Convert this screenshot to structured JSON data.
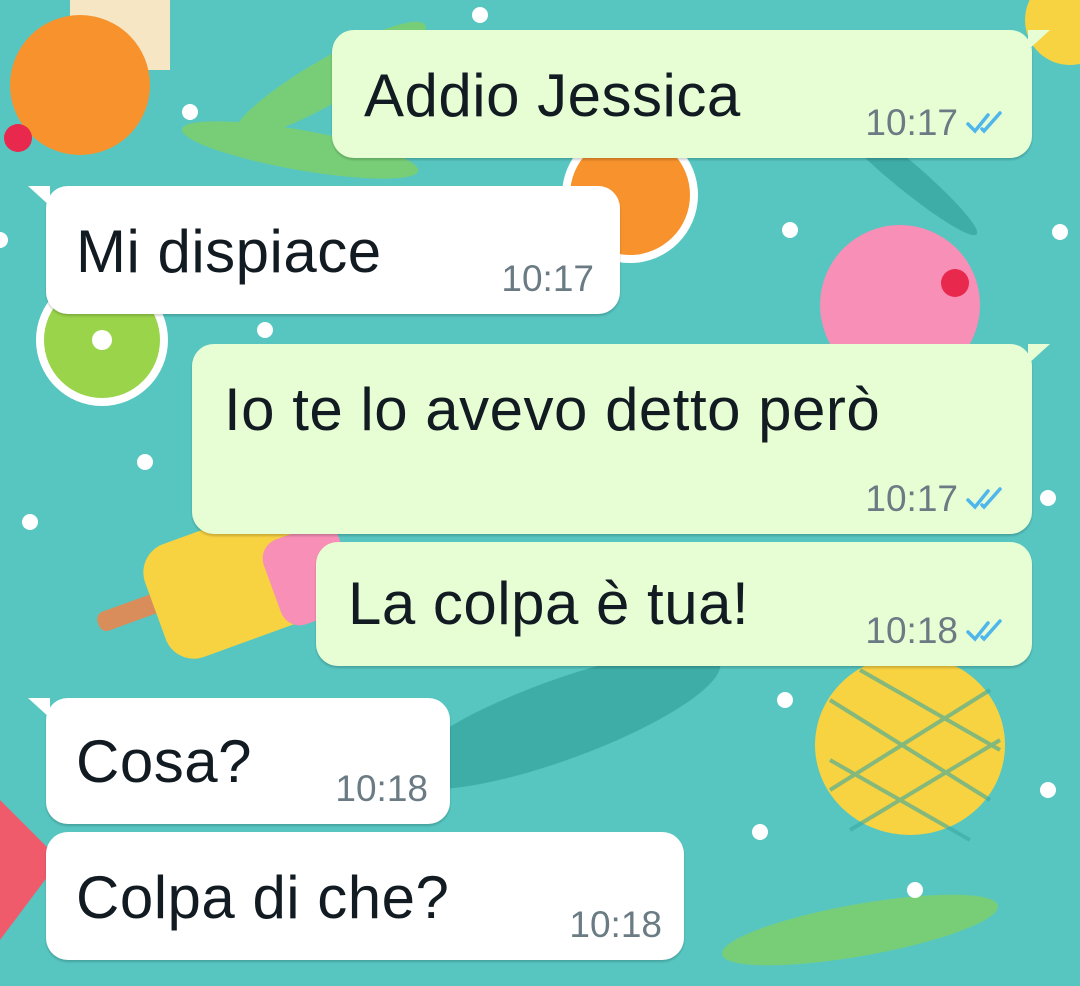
{
  "chat": {
    "messages": [
      {
        "direction": "out",
        "text": "Addio Jessica",
        "time": "10:17",
        "status": "read"
      },
      {
        "direction": "in",
        "text": "Mi dispiace",
        "time": "10:17"
      },
      {
        "direction": "out",
        "text": "Io te lo avevo detto però",
        "time": "10:17",
        "status": "read"
      },
      {
        "direction": "out",
        "text": "La colpa è tua!",
        "time": "10:18",
        "status": "read"
      },
      {
        "direction": "in",
        "text": "Cosa?",
        "time": "10:18"
      },
      {
        "direction": "in",
        "text": "Colpa di che?",
        "time": "10:18"
      }
    ]
  },
  "icons": {
    "read_receipt": "double-check-icon"
  },
  "colors": {
    "wallpaper": "#57c6c1",
    "outgoing_bubble": "#e7fed5",
    "incoming_bubble": "#ffffff",
    "read_tick": "#4fb6ec",
    "timestamp": "#6b7b84"
  }
}
